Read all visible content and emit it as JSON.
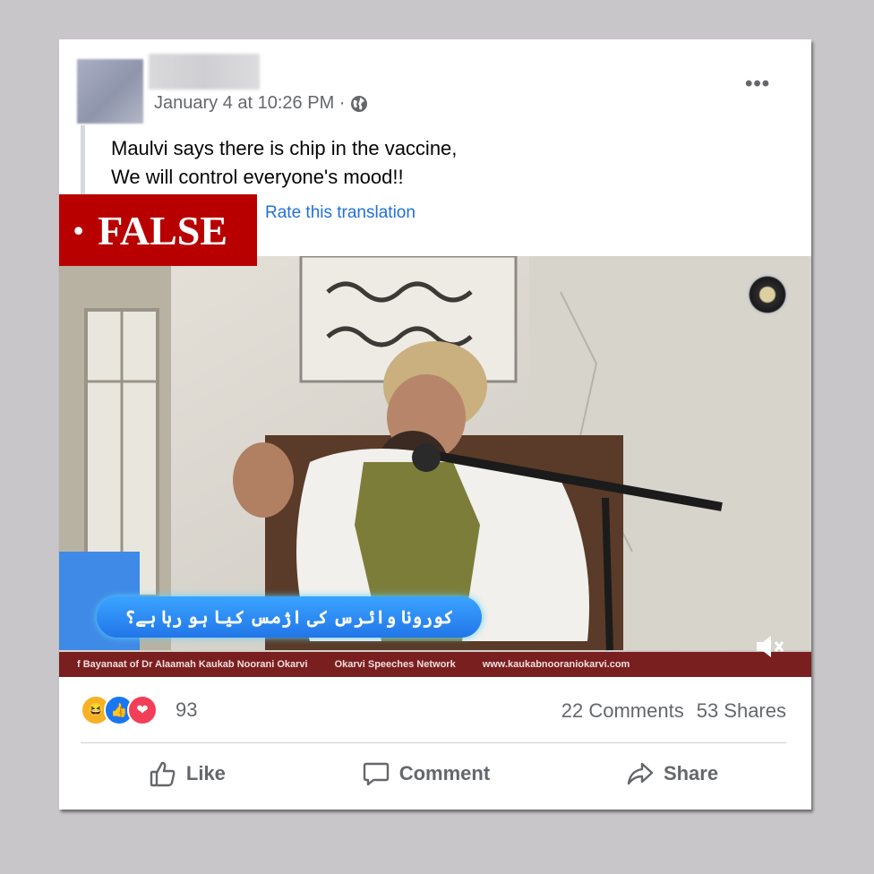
{
  "post": {
    "timestamp": "January 4 at 10:26 PM ·",
    "audience_icon": "globe-icon",
    "more_label": "•••",
    "text": "Maulvi says there is chip in the vaccine,\nWe will control everyone's mood!!",
    "rate_translation": "Rate this translation"
  },
  "badge": {
    "bullet": "•",
    "label": "FALSE",
    "color": "#b80000"
  },
  "video": {
    "caption": "کورونا وائرس کی اژمس کیا ہو رہا ہے؟",
    "ticker": [
      "f Bayanaat of Dr Alaamah Kaukab Noorani Okarvi",
      "Okarvi Speeches Network",
      "www.kaukabnooraniokarvi.com"
    ],
    "mute_icon": "mute-icon"
  },
  "engagement": {
    "reaction_icons": [
      "haha-icon",
      "like-icon",
      "love-icon"
    ],
    "reaction_count": "93",
    "comments": "22 Comments",
    "shares": "53 Shares"
  },
  "actions": {
    "like": "Like",
    "comment": "Comment",
    "share": "Share"
  },
  "colors": {
    "link": "#216fdb",
    "secondary_text": "#65676b",
    "background": "#c8c6c8"
  }
}
